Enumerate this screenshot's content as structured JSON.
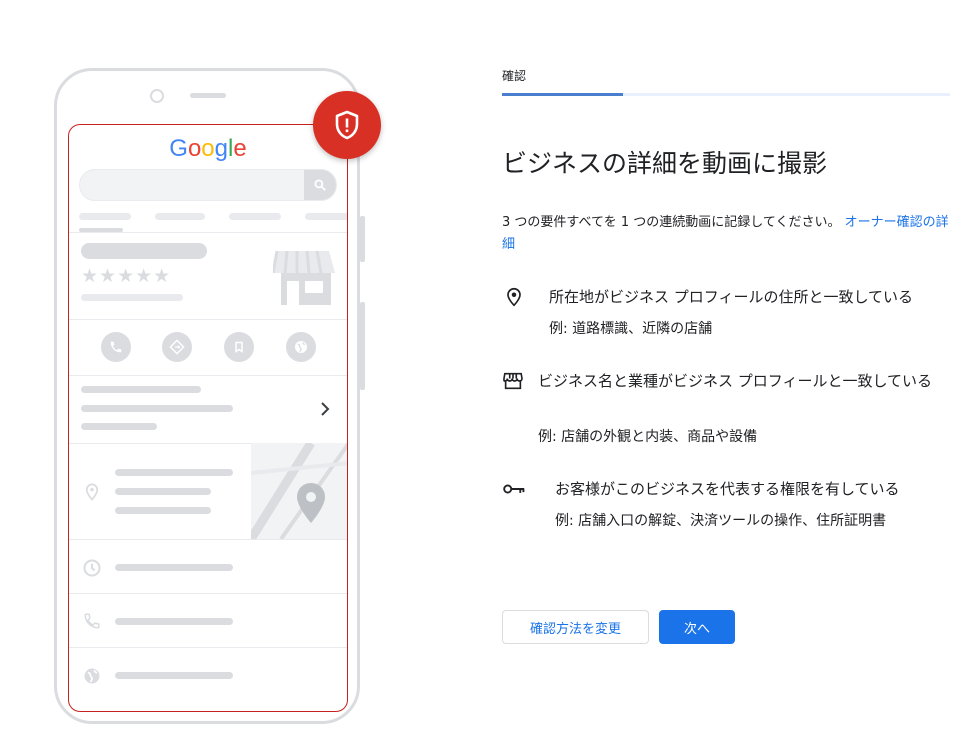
{
  "phone": {
    "logo_letters": [
      {
        "ch": "G",
        "color": "#4285F4"
      },
      {
        "ch": "o",
        "color": "#EA4335"
      },
      {
        "ch": "o",
        "color": "#FBBC05"
      },
      {
        "ch": "g",
        "color": "#4285F4"
      },
      {
        "ch": "l",
        "color": "#34A853"
      },
      {
        "ch": "e",
        "color": "#EA4335"
      }
    ],
    "stars": "★★★★★",
    "badge_icon": "shield-alert-icon",
    "action_icons": [
      "phone-icon",
      "directions-icon",
      "bookmark-icon",
      "website-icon"
    ],
    "row_icons": [
      "location-pin-icon",
      "clock-icon",
      "phone-icon",
      "globe-icon"
    ]
  },
  "step": {
    "label": "確認",
    "progress": 0.27
  },
  "page": {
    "title": "ビジネスの詳細を動画に撮影",
    "intro_text": "3 つの要件すべてを 1 つの連続動画に記録してください。",
    "intro_link": "オーナー確認の詳細"
  },
  "requirements": [
    {
      "icon": "location-pin-icon",
      "main": "所在地がビジネス プロフィールの住所と一致している",
      "example": "例: 道路標識、近隣の店舗"
    },
    {
      "icon": "storefront-icon",
      "main": "ビジネス名と業種がビジネス プロフィールと一致している",
      "example": "例: 店舗の外観と内装、商品や設備"
    },
    {
      "icon": "key-icon",
      "main": "お客様がこのビジネスを代表する権限を有している",
      "example": "例: 店舗入口の解錠、決済ツールの操作、住所証明書"
    }
  ],
  "buttons": {
    "change_method": "確認方法を変更",
    "next": "次へ"
  },
  "colors": {
    "accent": "#1a73e8",
    "alert_red": "#d93025",
    "progress": "#4a7fcf"
  }
}
